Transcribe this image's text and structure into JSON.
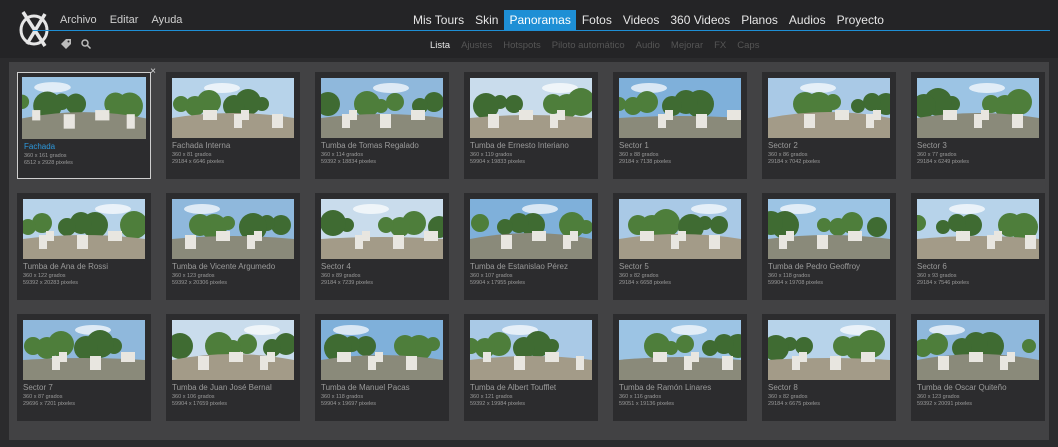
{
  "menu": [
    "Archivo",
    "Editar",
    "Ayuda"
  ],
  "mainnav": [
    "Mis Tours",
    "Skin",
    "Panoramas",
    "Fotos",
    "Videos",
    "360 Videos",
    "Planos",
    "Audios",
    "Proyecto"
  ],
  "mainnav_active": "Panoramas",
  "tools": [
    "tag-icon",
    "search-icon"
  ],
  "subnav": [
    "Lista",
    "Ajustes",
    "Hotspots",
    "Piloto automático",
    "Audio",
    "Mejorar",
    "FX",
    "Caps"
  ],
  "subnav_active": "Lista",
  "accent": "#1e8fd5",
  "panoramas": [
    {
      "title": "Fachada",
      "angles": "360 x 161 grados",
      "pixels": "6512 x 2928 pixeles",
      "selected": true
    },
    {
      "title": "Fachada Interna",
      "angles": "360 x 81 grados",
      "pixels": "29184 x 6646 pixeles"
    },
    {
      "title": "Tumba de Tomas Regalado",
      "angles": "360 x 114 grados",
      "pixels": "59392 x 18834 pixeles"
    },
    {
      "title": "Tumba de Ernesto Interiano",
      "angles": "360 x 119 grados",
      "pixels": "59904 x 19833 pixeles"
    },
    {
      "title": "Sector 1",
      "angles": "360 x 88 grados",
      "pixels": "29184 x 7138 pixeles"
    },
    {
      "title": "Sector 2",
      "angles": "360 x 86 grados",
      "pixels": "29184 x 7042 pixeles"
    },
    {
      "title": "Sector 3",
      "angles": "360 x 77 grados",
      "pixels": "29184 x 6249 pixeles"
    },
    {
      "title": "Tumba de Ana de Rossi",
      "angles": "360 x 122 grados",
      "pixels": "59392 x 20283 pixeles"
    },
    {
      "title": "Tumba de Vicente Argumedo",
      "angles": "360 x 123 grados",
      "pixels": "59392 x 20306 pixeles"
    },
    {
      "title": "Sector 4",
      "angles": "360 x 89 grados",
      "pixels": "29184 x 7239 pixeles"
    },
    {
      "title": "Tumba de Estanislao Pérez",
      "angles": "360 x 107 grados",
      "pixels": "59904 x 17955 pixeles"
    },
    {
      "title": "Sector 5",
      "angles": "360 x 82 grados",
      "pixels": "29184 x 6658 pixeles"
    },
    {
      "title": "Tumba de Pedro Geoffroy",
      "angles": "360 x 118 grados",
      "pixels": "59904 x 19708 pixeles"
    },
    {
      "title": "Sector 6",
      "angles": "360 x 93 grados",
      "pixels": "29184 x 7546 pixeles"
    },
    {
      "title": "Sector 7",
      "angles": "360 x 87 grados",
      "pixels": "29696 x 7201 pixeles"
    },
    {
      "title": "Tumba de Juan José Bernal",
      "angles": "360 x 106 grados",
      "pixels": "59904 x 17659 pixeles"
    },
    {
      "title": "Tumba de Manuel Pacas",
      "angles": "360 x 118 grados",
      "pixels": "59904 x 19697 pixeles"
    },
    {
      "title": "Tumba de Albert Toufflet",
      "angles": "360 x 121 grados",
      "pixels": "59392 x 19984 pixeles"
    },
    {
      "title": "Tumba de Ramón Linares",
      "angles": "360 x 116 grados",
      "pixels": "59051 x 19136 pixeles"
    },
    {
      "title": "Sector 8",
      "angles": "360 x 82 grados",
      "pixels": "29184 x 6675 pixeles"
    },
    {
      "title": "Tumba de Oscar Quiteño",
      "angles": "360 x 123 grados",
      "pixels": "59392 x 20091 pixeles"
    }
  ]
}
